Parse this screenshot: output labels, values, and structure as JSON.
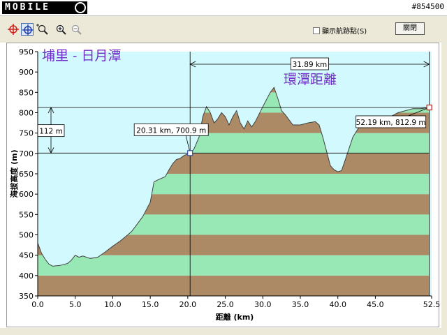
{
  "window": {
    "logo_text": "MOBILE",
    "window_id": "#854500"
  },
  "toolbar": {
    "tools": [
      "crosshair-red-icon",
      "crosshair-blue-icon",
      "zoom-cursor-icon",
      "zoom-in-icon",
      "zoom-out-icon"
    ],
    "show_track_label": "顯示航跡點(S)",
    "show_track_checked": false,
    "close_label": "關閉"
  },
  "colors": {
    "sky": "#d2f9fd",
    "band_brown": "#ab8a65",
    "band_green": "#98e8b5",
    "route_text": "#7030c8",
    "marker_blue": "#3050b0",
    "marker_red": "#c02020"
  },
  "chart_data": {
    "type": "area",
    "xlabel": "距離  (km)",
    "ylabel": "海拔高度 (m)",
    "xlim": [
      0,
      52.5
    ],
    "ylim": [
      350,
      950
    ],
    "xticks": [
      "0.0",
      "5.0",
      "10.0",
      "15.0",
      "20.0",
      "25.0",
      "30.0",
      "35.0",
      "40.0",
      "45.0",
      "52.5"
    ],
    "yticks": [
      "350",
      "400",
      "450",
      "500",
      "550",
      "600",
      "650",
      "700",
      "750",
      "800",
      "850",
      "900",
      "950"
    ],
    "grid": false,
    "annotations": {
      "route_start_end": "埔里 - 日月潭",
      "loop_distance_label": "環潭距離",
      "distance_span_label": "31.89 km",
      "elevation_diff_label": "112 m",
      "point_a_label": "20.31 km, 700.9 m",
      "point_b_label": "52.19 km, 812.9 m"
    },
    "markers": [
      {
        "x": 20.31,
        "y": 700.9
      },
      {
        "x": 52.19,
        "y": 812.9
      }
    ],
    "profile": {
      "x": [
        0,
        0.5,
        1,
        1.5,
        2,
        3,
        4,
        4.5,
        5,
        5.5,
        6,
        7,
        8,
        9,
        10,
        11,
        12,
        12.5,
        13,
        14,
        15,
        15.5,
        16,
        17,
        17.5,
        18,
        18.5,
        19,
        19.5,
        20.31,
        20.8,
        21.5,
        22,
        22.5,
        23,
        23.5,
        24,
        24.5,
        25,
        25.5,
        26,
        26.5,
        27,
        27.5,
        28,
        28.5,
        29,
        30,
        31,
        31.5,
        32,
        32.5,
        33,
        34,
        35,
        36,
        37,
        37.5,
        38,
        38.5,
        39,
        39.5,
        40,
        40.5,
        41,
        42,
        43,
        44,
        45,
        46,
        47,
        48,
        49,
        50,
        51,
        52,
        52.19
      ],
      "y": [
        480,
        455,
        440,
        428,
        423,
        425,
        430,
        438,
        450,
        445,
        448,
        442,
        445,
        458,
        472,
        485,
        500,
        508,
        520,
        545,
        580,
        630,
        635,
        643,
        660,
        675,
        685,
        688,
        695,
        700.9,
        710,
        740,
        790,
        815,
        800,
        775,
        785,
        800,
        790,
        770,
        790,
        805,
        775,
        760,
        780,
        765,
        778,
        815,
        850,
        862,
        835,
        805,
        795,
        770,
        770,
        775,
        778,
        770,
        740,
        705,
        670,
        660,
        655,
        658,
        685,
        740,
        770,
        775,
        780,
        785,
        790,
        800,
        805,
        810,
        810,
        812,
        812.9
      ]
    }
  }
}
